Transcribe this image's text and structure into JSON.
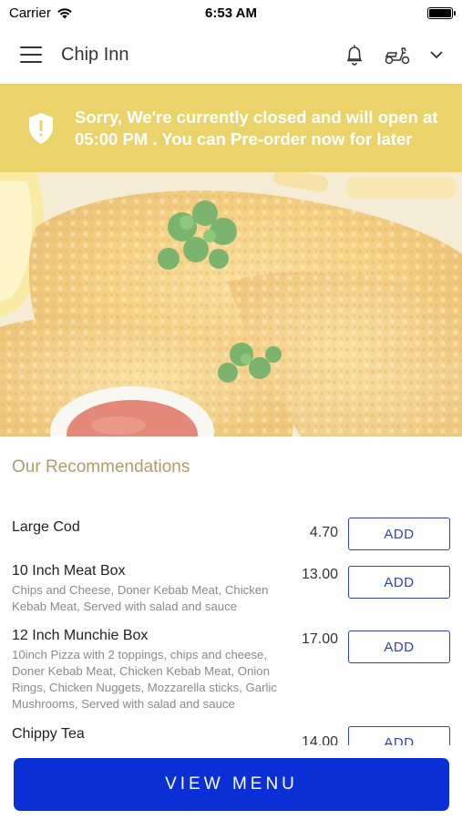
{
  "status_bar": {
    "carrier": "Carrier",
    "time": "6:53 AM"
  },
  "header": {
    "title": "Chip Inn",
    "icons": [
      "menu-icon",
      "bell-icon",
      "scooter-icon",
      "chevron-down-icon"
    ]
  },
  "banner": {
    "text": "Sorry, We're currently closed and will open at 05:00 PM . You can Pre-order now for later",
    "background": "#ead36a",
    "icon": "shield-icon"
  },
  "recommendations": {
    "title": "Our Recommendations",
    "add_label": "ADD",
    "items": [
      {
        "name": "Large Cod",
        "description": "",
        "price": "4.70"
      },
      {
        "name": "10 Inch Meat Box",
        "description": "Chips and Cheese, Doner Kebab Meat, Chicken Kebab Meat, Served with salad and sauce",
        "price": "13.00"
      },
      {
        "name": "12 Inch Munchie Box",
        "description": "10inch Pizza with 2 toppings, chips and cheese, Doner Kebab Meat, Chicken Kebab Meat, Onion Rings, Chicken Nuggets, Mozzarella sticks, Garlic Mushrooms, Served with salad and sauce",
        "price": "17.00"
      },
      {
        "name": "Chippy Tea",
        "description": "",
        "price": "14.00"
      }
    ]
  },
  "footer": {
    "view_menu_label": "VIEW MENU",
    "accent": "#0a2fd4"
  }
}
